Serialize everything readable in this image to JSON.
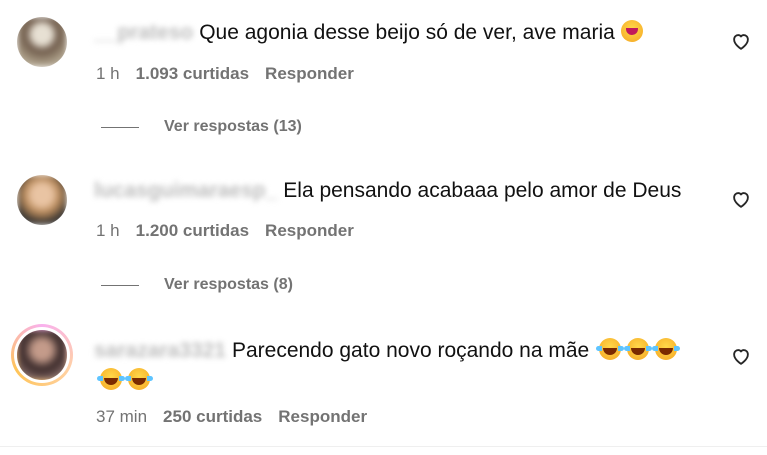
{
  "comments": [
    {
      "username": "__prateso",
      "text": "Que agonia desse beijo só de ver, ave maria",
      "emojis": [
        "face-ew"
      ],
      "time": "1 h",
      "likes": "1.093 curtidas",
      "reply_label": "Responder",
      "view_replies": "Ver respostas (13)",
      "avatar_colors": [
        "#6e5a4a",
        "#d8d2c5"
      ]
    },
    {
      "username": "lucasguimaraesp_",
      "text": "Ela pensando acabaaa pelo amor de Deus",
      "emojis": [],
      "time": "1 h",
      "likes": "1.200 curtidas",
      "reply_label": "Responder",
      "view_replies": "Ver respostas (8)",
      "avatar_colors": [
        "#b88a5c",
        "#2c2c2c"
      ]
    },
    {
      "username": "sarazara3321",
      "text": "Parecendo gato novo roçando na mãe",
      "emojis": [
        "laugh",
        "laugh",
        "laugh",
        "laugh",
        "laugh"
      ],
      "time": "37 min",
      "likes": "250 curtidas",
      "reply_label": "Responder",
      "avatar_colors": [
        "#3a2a2a",
        "#c49b8a"
      ]
    }
  ],
  "icons": {
    "heart": "heart-icon",
    "face-ew": "tired-face-emoji",
    "laugh": "tears-of-joy-emoji"
  }
}
